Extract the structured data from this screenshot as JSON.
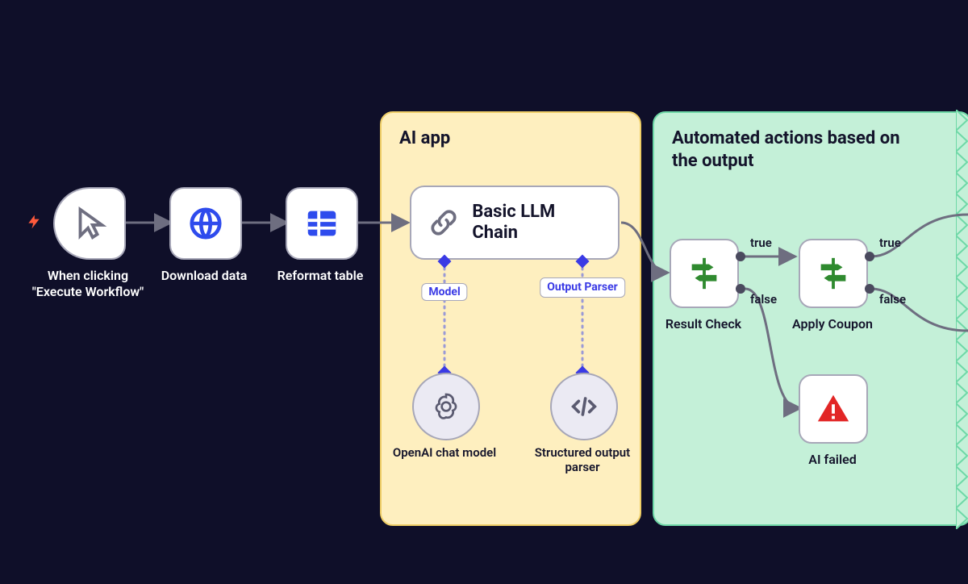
{
  "panels": {
    "ai": {
      "title": "AI app"
    },
    "auto": {
      "title": "Automated actions based on the output"
    }
  },
  "nodes": {
    "trigger": {
      "label": "When clicking \"Execute Workflow\""
    },
    "download": {
      "label": "Download data"
    },
    "reformat": {
      "label": "Reformat table"
    },
    "llm": {
      "title": "Basic LLM Chain"
    },
    "model_tag": "Model",
    "output_parser_tag": "Output Parser",
    "openai": {
      "label": "OpenAI chat model"
    },
    "structured": {
      "label": "Structured output parser"
    },
    "result_check": {
      "label": "Result Check"
    },
    "apply_coupon": {
      "label": "Apply Coupon"
    },
    "ai_failed": {
      "label": "AI failed"
    }
  },
  "edges": {
    "true": "true",
    "false": "false"
  }
}
